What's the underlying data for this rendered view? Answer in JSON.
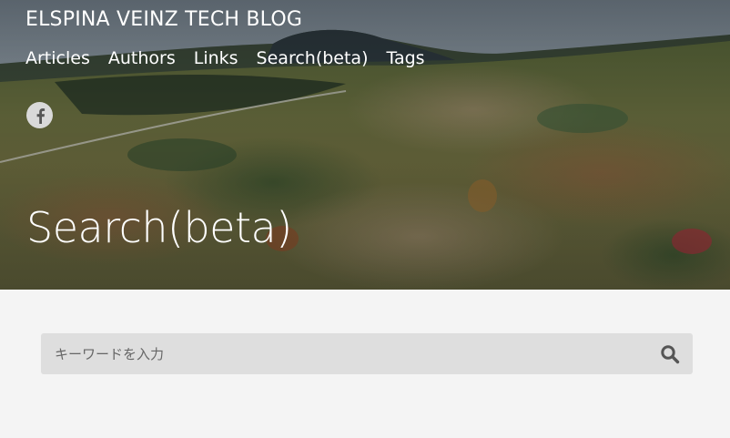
{
  "header": {
    "site_title": "ELSPINA VEINZ TECH BLOG",
    "nav": [
      "Articles",
      "Authors",
      "Links",
      "Search(beta)",
      "Tags"
    ],
    "social_icon": "facebook-icon",
    "page_heading": "Search(beta)"
  },
  "search": {
    "placeholder": "キーワードを入力",
    "value": "",
    "button_icon": "search-icon"
  },
  "colors": {
    "content_bg": "#f4f4f4",
    "search_box_bg": "#dedede",
    "header_text": "#ffffff",
    "icon_grey": "#555555"
  }
}
